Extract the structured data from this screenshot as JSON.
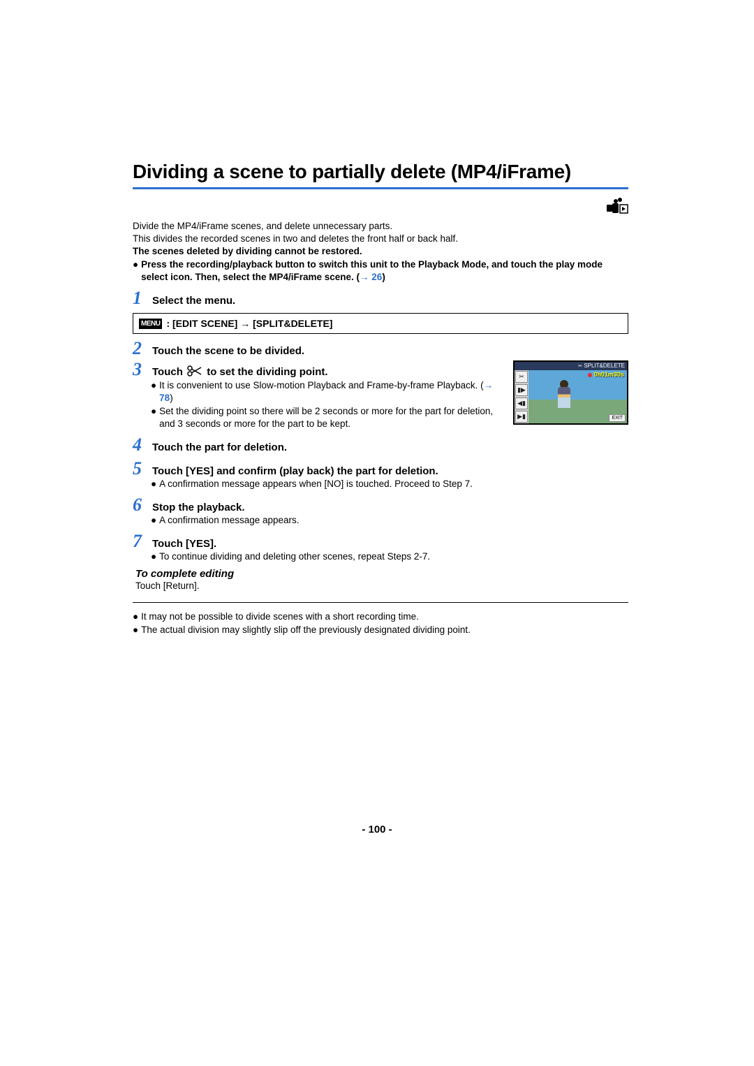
{
  "title": "Dividing a scene to partially delete (MP4/iFrame)",
  "intro": {
    "line1": "Divide the MP4/iFrame scenes, and delete unnecessary parts.",
    "line2": "This divides the recorded scenes in two and deletes the front half or back half.",
    "line3": "The scenes deleted by dividing cannot be restored.",
    "bullet_pre": "Press the recording/playback button to switch this unit to the Playback Mode, and touch the play mode select icon. Then, select the MP4/iFrame scene. (",
    "bullet_link_arrow": "→",
    "bullet_link_num": "26",
    "bullet_post": ")"
  },
  "steps": {
    "s1": {
      "num": "1",
      "head": "Select the menu."
    },
    "menu": {
      "badge": "MENU",
      "text": ": [EDIT SCENE] → [SPLIT&DELETE]"
    },
    "s2": {
      "num": "2",
      "head": "Touch the scene to be divided."
    },
    "s3": {
      "num": "3",
      "head_pre": "Touch ",
      "head_post": " to set the dividing point.",
      "p1_pre": "It is convenient to use Slow-motion Playback and Frame-by-frame Playback. (",
      "p1_link_arrow": "→",
      "p1_link_num": "78",
      "p1_post": ")",
      "p2": "Set the dividing point so there will be 2 seconds or more for the part for deletion, and 3 seconds or more for the part to be kept."
    },
    "s4": {
      "num": "4",
      "head": "Touch the part for deletion."
    },
    "s5": {
      "num": "5",
      "head": "Touch [YES] and confirm (play back) the part for deletion.",
      "p1": "A confirmation message appears when [NO] is touched. Proceed to Step 7."
    },
    "s6": {
      "num": "6",
      "head": "Stop the playback.",
      "p1": "A confirmation message appears."
    },
    "s7": {
      "num": "7",
      "head": "Touch [YES].",
      "p1": "To continue dividing and deleting other scenes, repeat Steps 2-7."
    }
  },
  "complete": {
    "title": "To complete editing",
    "body": "Touch [Return]."
  },
  "notes": {
    "n1": "It may not be possible to divide scenes with a short recording time.",
    "n2": "The actual division may slightly slip off the previously designated dividing point."
  },
  "thumb": {
    "top_label": "SPLIT&DELETE",
    "timer": "0h01m30s",
    "exit": "EXIT"
  },
  "page_number": "- 100 -"
}
